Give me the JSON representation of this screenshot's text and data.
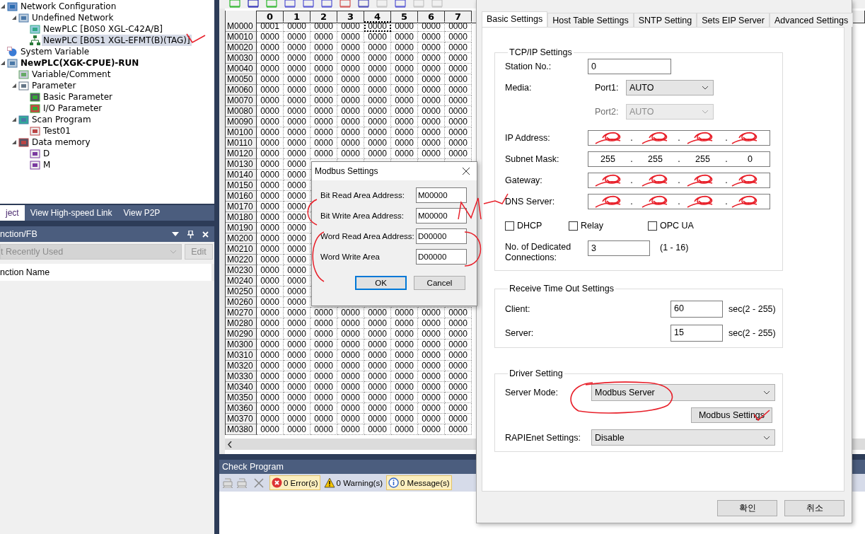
{
  "tree": [
    {
      "label": "Network Configuration",
      "kind": "network",
      "expanded": true,
      "selected": false,
      "active": false,
      "children": [
        {
          "label": "Undefined Network",
          "kind": "group",
          "expanded": true,
          "selected": false,
          "active": false,
          "children": [
            {
              "label": "NewPLC [B0S0 XGL-C42A/B]",
              "kind": "serial",
              "selected": false,
              "active": false
            },
            {
              "label": "NewPLC [B0S1 XGL-EFMT(B)(TAG)]",
              "kind": "ethernet",
              "selected": true,
              "active": false
            }
          ]
        }
      ]
    },
    {
      "label": "System Variable",
      "kind": "globe",
      "selected": false,
      "active": false
    },
    {
      "label": "NewPLC(XGK-CPUE)-RUN",
      "kind": "group",
      "expanded": true,
      "selected": false,
      "active": true,
      "children": [
        {
          "label": "Variable/Comment",
          "kind": "comment",
          "selected": false,
          "active": false
        },
        {
          "label": "Parameter",
          "kind": "hand",
          "expanded": true,
          "selected": false,
          "active": false,
          "children": [
            {
              "label": "Basic Parameter",
              "kind": "param",
              "selected": false,
              "active": false
            },
            {
              "label": "I/O Parameter",
              "kind": "io",
              "selected": false,
              "active": false
            }
          ]
        },
        {
          "label": "Scan Program",
          "kind": "program",
          "expanded": true,
          "selected": false,
          "active": false,
          "children": [
            {
              "label": "Test01",
              "kind": "task",
              "selected": false,
              "active": false
            }
          ]
        },
        {
          "label": "Data memory",
          "kind": "memory",
          "expanded": true,
          "selected": false,
          "active": false,
          "children": [
            {
              "label": "D",
              "kind": "chip",
              "selected": false,
              "active": false
            },
            {
              "label": "M",
              "kind": "chip",
              "selected": false,
              "active": false
            }
          ]
        }
      ]
    }
  ],
  "left_tabs": [
    {
      "label": "ject",
      "selected": true
    },
    {
      "label": "View High-speed Link",
      "selected": false
    },
    {
      "label": "View P2P",
      "selected": false
    }
  ],
  "function_panel": {
    "title": "nction/FB",
    "filter": {
      "value": "t Recently Used",
      "disabled": true
    },
    "edit_button": {
      "label": "Edit",
      "disabled": true
    },
    "column": "nction Name"
  },
  "memory_grid": {
    "columns": [
      "0",
      "1",
      "2",
      "3",
      "4",
      "5",
      "6",
      "7"
    ],
    "rows": [
      {
        "address": "M0000",
        "cells": [
          "0001",
          "0000",
          "0000",
          "0000",
          "0000",
          "0000",
          "0000",
          "0000"
        ],
        "cursor": [
          false,
          false,
          false,
          false,
          true,
          false,
          false,
          false
        ]
      },
      {
        "address": "M0010",
        "cells": [
          "0000",
          "0000",
          "0000",
          "0000",
          "0000",
          "0000",
          "0000",
          "0000"
        ]
      },
      {
        "address": "M0020",
        "cells": [
          "0000",
          "0000",
          "0000",
          "0000",
          "0000",
          "0000",
          "0000",
          "0000"
        ]
      },
      {
        "address": "M0030",
        "cells": [
          "0000",
          "0000",
          "0000",
          "0000",
          "0000",
          "0000",
          "0000",
          "0000"
        ]
      },
      {
        "address": "M0040",
        "cells": [
          "0000",
          "0000",
          "0000",
          "0000",
          "0000",
          "0000",
          "0000",
          "0000"
        ]
      },
      {
        "address": "M0050",
        "cells": [
          "0000",
          "0000",
          "0000",
          "0000",
          "0000",
          "0000",
          "0000",
          "0000"
        ]
      },
      {
        "address": "M0060",
        "cells": [
          "0000",
          "0000",
          "0000",
          "0000",
          "0000",
          "0000",
          "0000",
          "0000"
        ]
      },
      {
        "address": "M0070",
        "cells": [
          "0000",
          "0000",
          "0000",
          "0000",
          "0000",
          "0000",
          "0000",
          "0000"
        ]
      },
      {
        "address": "M0080",
        "cells": [
          "0000",
          "0000",
          "0000",
          "0000",
          "0000",
          "0000",
          "0000",
          "0000"
        ]
      },
      {
        "address": "M0090",
        "cells": [
          "0000",
          "0000",
          "0000",
          "0000",
          "0000",
          "0000",
          "0000",
          "0000"
        ]
      },
      {
        "address": "M0100",
        "cells": [
          "0000",
          "0000",
          "0000",
          "0000",
          "0000",
          "0000",
          "0000",
          "0000"
        ]
      },
      {
        "address": "M0110",
        "cells": [
          "0000",
          "0000",
          "0000",
          "0000",
          "0000",
          "0000",
          "0000",
          "0000"
        ]
      },
      {
        "address": "M0120",
        "cells": [
          "0000",
          "0000",
          "0000",
          "0000",
          "0000",
          "0000",
          "0000",
          "0000"
        ]
      },
      {
        "address": "M0130",
        "cells": [
          "0000",
          "0000"
        ]
      },
      {
        "address": "M0140",
        "cells": [
          "0000",
          "0000"
        ]
      },
      {
        "address": "M0150",
        "cells": [
          "0000",
          "0000"
        ]
      },
      {
        "address": "M0160",
        "cells": [
          "0000",
          "0000"
        ]
      },
      {
        "address": "M0170",
        "cells": [
          "0000",
          "0000"
        ]
      },
      {
        "address": "M0180",
        "cells": [
          "0000",
          "0000"
        ]
      },
      {
        "address": "M0190",
        "cells": [
          "0000",
          "0000"
        ]
      },
      {
        "address": "M0200",
        "cells": [
          "0000",
          "0000"
        ]
      },
      {
        "address": "M0210",
        "cells": [
          "0000",
          "0000"
        ]
      },
      {
        "address": "M0220",
        "cells": [
          "0000",
          "0000"
        ]
      },
      {
        "address": "M0230",
        "cells": [
          "0000",
          "0000"
        ]
      },
      {
        "address": "M0240",
        "cells": [
          "0000",
          "0000"
        ]
      },
      {
        "address": "M0250",
        "cells": [
          "0000",
          "0000"
        ]
      },
      {
        "address": "M0260",
        "cells": [
          "0000",
          "0000"
        ]
      },
      {
        "address": "M0270",
        "cells": [
          "0000",
          "0000",
          "0000",
          "0000",
          "0000",
          "0000",
          "0000",
          "0000"
        ]
      },
      {
        "address": "M0280",
        "cells": [
          "0000",
          "0000",
          "0000",
          "0000",
          "0000",
          "0000",
          "0000",
          "0000"
        ]
      },
      {
        "address": "M0290",
        "cells": [
          "0000",
          "0000",
          "0000",
          "0000",
          "0000",
          "0000",
          "0000",
          "0000"
        ]
      },
      {
        "address": "M0300",
        "cells": [
          "0000",
          "0000",
          "0000",
          "0000",
          "0000",
          "0000",
          "0000",
          "0000"
        ]
      },
      {
        "address": "M0310",
        "cells": [
          "0000",
          "0000",
          "0000",
          "0000",
          "0000",
          "0000",
          "0000",
          "0000"
        ]
      },
      {
        "address": "M0320",
        "cells": [
          "0000",
          "0000",
          "0000",
          "0000",
          "0000",
          "0000",
          "0000",
          "0000"
        ]
      },
      {
        "address": "M0330",
        "cells": [
          "0000",
          "0000",
          "0000",
          "0000",
          "0000",
          "0000",
          "0000",
          "0000"
        ]
      },
      {
        "address": "M0340",
        "cells": [
          "0000",
          "0000",
          "0000",
          "0000",
          "0000",
          "0000",
          "0000",
          "0000"
        ]
      },
      {
        "address": "M0350",
        "cells": [
          "0000",
          "0000",
          "0000",
          "0000",
          "0000",
          "0000",
          "0000",
          "0000"
        ]
      },
      {
        "address": "M0360",
        "cells": [
          "0000",
          "0000",
          "0000",
          "0000",
          "0000",
          "0000",
          "0000",
          "0000"
        ]
      },
      {
        "address": "M0370",
        "cells": [
          "0000",
          "0000",
          "0000",
          "0000",
          "0000",
          "0000",
          "0000",
          "0000"
        ]
      },
      {
        "address": "M0380",
        "cells": [
          "0000",
          "0000",
          "0000",
          "0000",
          "0000",
          "0000",
          "0000",
          "0000"
        ]
      }
    ]
  },
  "check_program": {
    "title": "Check Program",
    "filters": [
      {
        "label": "0 Error(s)",
        "kind": "error",
        "selected": true
      },
      {
        "label": "0 Warning(s)",
        "kind": "warning",
        "selected": false
      },
      {
        "label": "0 Message(s)",
        "kind": "info",
        "selected": true
      }
    ]
  },
  "settings_dialog": {
    "tabs": [
      {
        "label": "Basic Settings",
        "selected": true
      },
      {
        "label": "Host Table Settings",
        "selected": false
      },
      {
        "label": "SNTP Setting",
        "selected": false
      },
      {
        "label": "Sets EIP Server",
        "selected": false
      },
      {
        "label": "Advanced Settings",
        "selected": false
      }
    ],
    "tcpip": {
      "title": "TCP/IP Settings",
      "station": {
        "label": "Station No.:",
        "value": "0"
      },
      "media_label": "Media:",
      "ports": [
        {
          "label": "Port1:",
          "value": "AUTO",
          "disabled": false
        },
        {
          "label": "Port2:",
          "value": "AUTO",
          "disabled": true
        }
      ],
      "addresses": [
        {
          "label": "IP Address:",
          "redacted": true,
          "separator": "."
        },
        {
          "label": "Subnet Mask:",
          "redacted": false,
          "separator": ".",
          "octets": [
            "255",
            "255",
            "255",
            "0"
          ]
        },
        {
          "label": "Gateway:",
          "redacted": true,
          "separator": "."
        },
        {
          "label": "DNS Server:",
          "redacted": true,
          "separator": "."
        }
      ],
      "options": [
        {
          "label": "DHCP",
          "checked": false
        },
        {
          "label": "Relay",
          "checked": false
        },
        {
          "label": "OPC UA",
          "checked": false
        }
      ],
      "connections": {
        "label": "No. of Dedicated Connections:",
        "value": "3",
        "range": "(1 - 16)"
      }
    },
    "timeouts": {
      "title": "Receive Time Out Settings",
      "items": [
        {
          "label": "Client:",
          "value": "60",
          "range": "sec(2 - 255)"
        },
        {
          "label": "Server:",
          "value": "15",
          "range": "sec(2 - 255)"
        }
      ]
    },
    "driver": {
      "title": "Driver Setting",
      "server_mode": {
        "label": "Server Mode:",
        "value": "Modbus Server"
      },
      "modbus_button": "Modbus Settings",
      "rapienet": {
        "label": "RAPIEnet Settings:",
        "value": "Disable"
      }
    },
    "buttons": [
      {
        "label": "확인"
      },
      {
        "label": "취소"
      }
    ]
  },
  "modbus_dialog": {
    "title": "Modbus Settings",
    "fields": [
      {
        "label": "Bit Read Area Address:",
        "value": "M00000"
      },
      {
        "label": "Bit Write Area Address:",
        "value": "M00000"
      },
      {
        "label": "Word Read Area Address:",
        "value": "D00000"
      },
      {
        "label": "Word Write Area",
        "value": "D00000"
      }
    ],
    "buttons": [
      {
        "label": "OK",
        "default": true
      },
      {
        "label": "Cancel",
        "default": false
      }
    ]
  }
}
